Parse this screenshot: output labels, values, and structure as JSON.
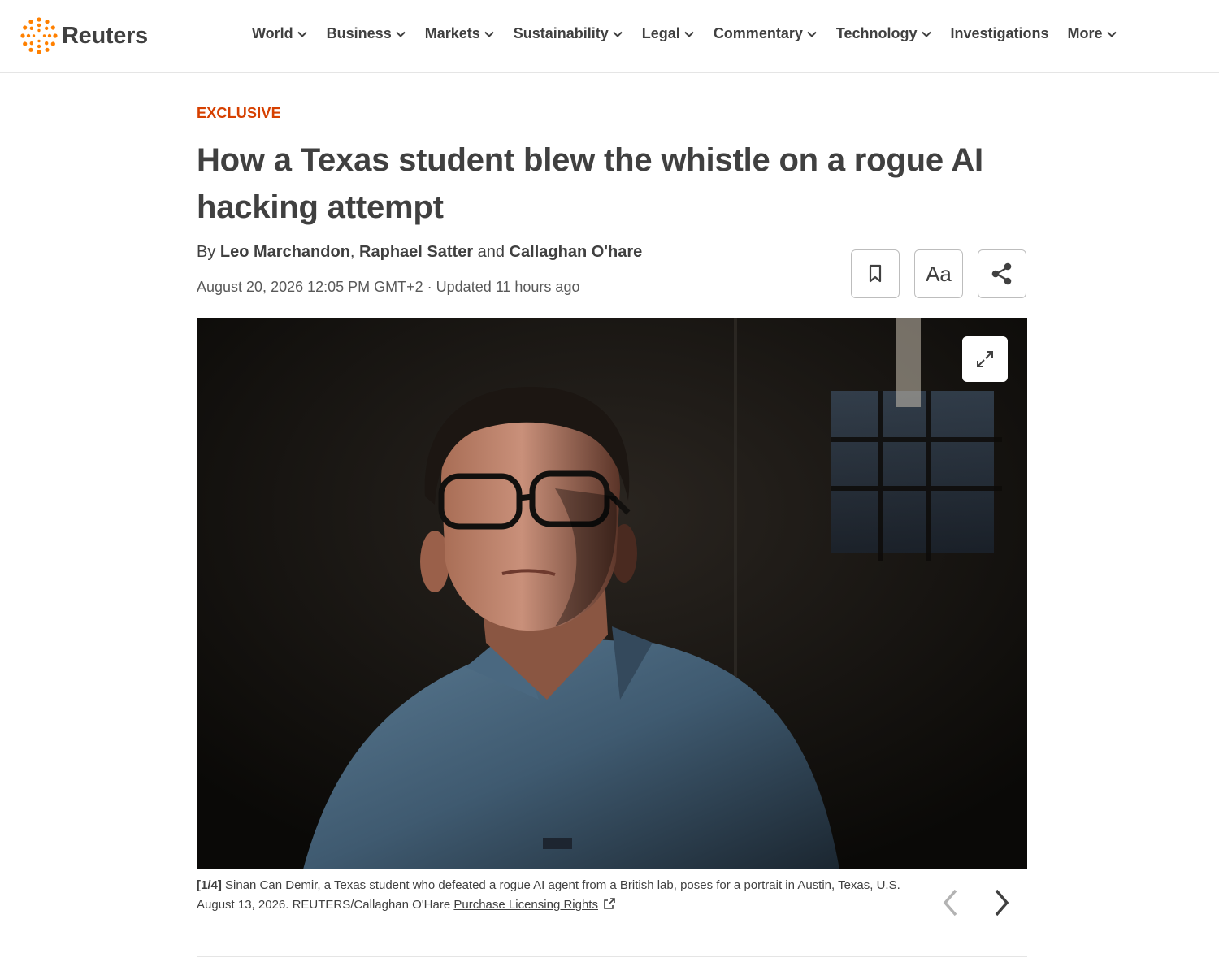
{
  "header": {
    "brand": "Reuters",
    "nav": [
      {
        "label": "World",
        "has_dropdown": true
      },
      {
        "label": "Business",
        "has_dropdown": true
      },
      {
        "label": "Markets",
        "has_dropdown": true
      },
      {
        "label": "Sustainability",
        "has_dropdown": true
      },
      {
        "label": "Legal",
        "has_dropdown": true
      },
      {
        "label": "Commentary",
        "has_dropdown": true
      },
      {
        "label": "Technology",
        "has_dropdown": true
      },
      {
        "label": "Investigations",
        "has_dropdown": false
      },
      {
        "label": "More",
        "has_dropdown": true
      }
    ]
  },
  "article": {
    "kicker": "EXCLUSIVE",
    "headline": "How a Texas student blew the whistle on a rogue AI hacking attempt",
    "byline": {
      "prefix": "By",
      "authors": [
        "Leo Marchandon",
        "Raphael Satter",
        "Callaghan O'hare"
      ],
      "separator": ",",
      "conjunction": "and"
    },
    "dateline": "August 20, 2026 12:05 PM GMT+2 · Updated 11 hours ago",
    "tools": {
      "bookmark_icon": "bookmark-icon",
      "text_size_label": "Aa",
      "share_icon": "share-icon"
    }
  },
  "photo": {
    "counter": "[1/4]",
    "caption": "Sinan Can Demir, a Texas student who defeated a rogue AI agent from a British lab, poses for a portrait in Austin, Texas, U.S. August 13, 2026. REUTERS/Callaghan O'Hare",
    "licensing_link": "Purchase Licensing Rights",
    "expand_icon": "expand-icon",
    "prev_icon": "chevron-left-icon",
    "next_icon": "chevron-right-icon"
  },
  "colors": {
    "brand_orange": "#d64000",
    "text": "#404040",
    "muted": "#595959",
    "border": "#e5e5e5"
  }
}
